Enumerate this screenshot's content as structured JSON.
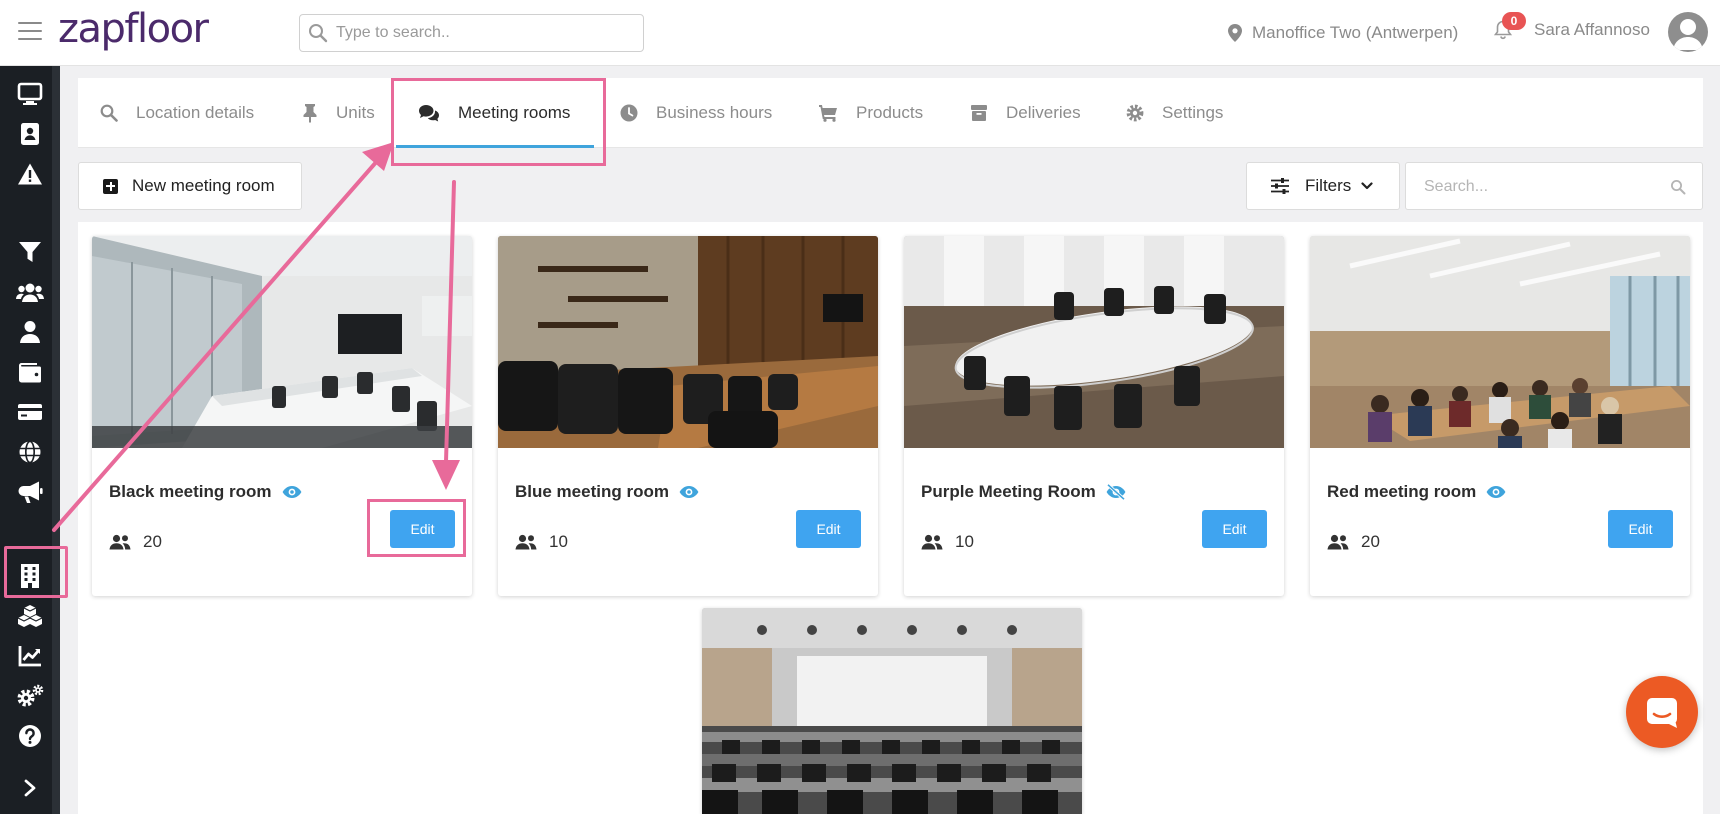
{
  "app": {
    "logo_text": "zapfloor",
    "search_placeholder": "Type to search..",
    "location": "Manoffice Two (Antwerpen)",
    "notification_count": "0",
    "user_name": "Sara Affannoso"
  },
  "sidebar": {
    "icons": [
      "desktop-icon",
      "address-book-icon",
      "warning-icon",
      "filter-icon",
      "users-icon",
      "user-icon",
      "wallet-icon",
      "credit-card-icon",
      "globe-icon",
      "megaphone-icon",
      "building-icon",
      "cubes-icon",
      "chart-line-icon",
      "cogs-icon",
      "help-icon",
      "expand-chevron-icon"
    ],
    "active": "building-icon"
  },
  "tabs": [
    {
      "label": "Location details",
      "icon": "search-icon"
    },
    {
      "label": "Units",
      "icon": "thumbtack-icon"
    },
    {
      "label": "Meeting rooms",
      "icon": "comments-icon",
      "active": true
    },
    {
      "label": "Business hours",
      "icon": "clock-icon"
    },
    {
      "label": "Products",
      "icon": "cart-icon"
    },
    {
      "label": "Deliveries",
      "icon": "box-icon"
    },
    {
      "label": "Settings",
      "icon": "gear-icon"
    }
  ],
  "toolbar": {
    "new_label": "New meeting room",
    "filters_label": "Filters",
    "search_placeholder": "Search..."
  },
  "rooms": [
    {
      "name": "Black meeting room",
      "capacity": "20",
      "visible": true,
      "edit_label": "Edit"
    },
    {
      "name": "Blue meeting room",
      "capacity": "10",
      "visible": true,
      "edit_label": "Edit"
    },
    {
      "name": "Purple Meeting Room",
      "capacity": "10",
      "visible": false,
      "edit_label": "Edit"
    },
    {
      "name": "Red meeting room",
      "capacity": "20",
      "visible": true,
      "edit_label": "Edit"
    }
  ],
  "colors": {
    "accent": "#3fa4f0",
    "tab_underline": "#3fa4dc",
    "highlight": "#e86a9a",
    "brand": "#4b2a6b",
    "nav_bg": "#1b1f24",
    "chat": "#ec5a24"
  }
}
